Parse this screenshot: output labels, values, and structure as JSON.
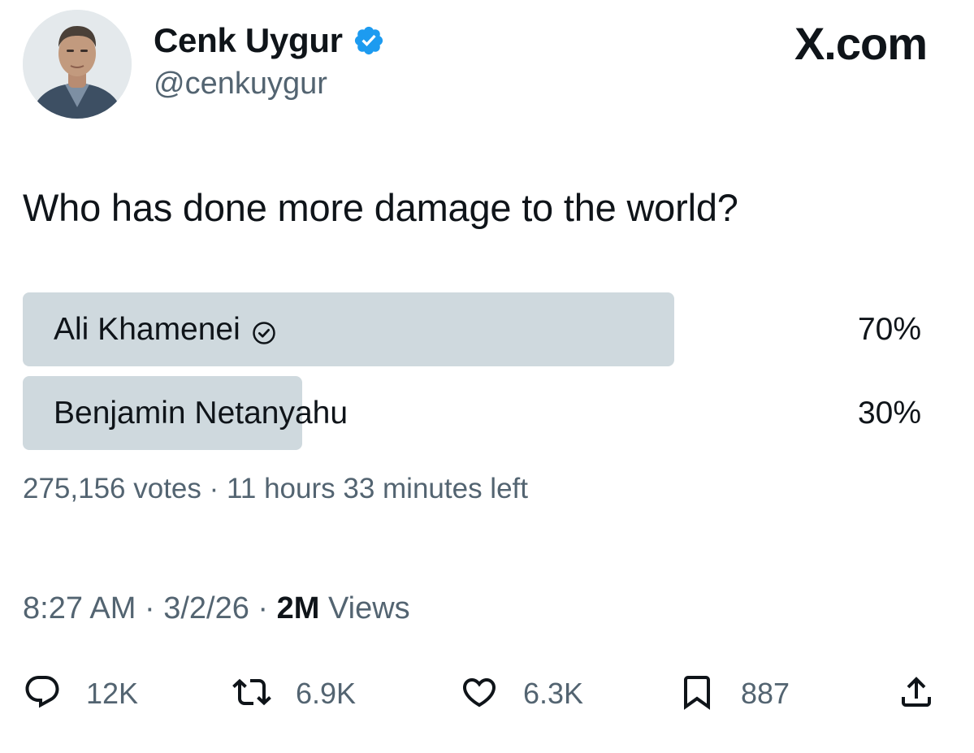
{
  "author": {
    "display_name": "Cenk Uygur",
    "handle": "@cenkuygur",
    "verified": true,
    "verified_color": "#1d9bf0"
  },
  "watermark": "X.com",
  "tweet": {
    "text": "Who has done more damage to the world?"
  },
  "poll": {
    "options": [
      {
        "label": "Ali Khamenei",
        "percent_text": "70%",
        "share": 0.7,
        "winner": true
      },
      {
        "label": "Benjamin Netanyahu",
        "percent_text": "30%",
        "share": 0.3,
        "winner": false
      }
    ],
    "votes_text": "275,156 votes",
    "time_left_text": "11 hours 33 minutes left",
    "bar_color": "#cfd9de"
  },
  "meta": {
    "time": "8:27 AM",
    "date": "3/2/26",
    "views_count": "2M",
    "views_label": "Views"
  },
  "actions": {
    "reply": {
      "icon": "reply-icon",
      "count": "12K"
    },
    "repost": {
      "icon": "repost-icon",
      "count": "6.9K"
    },
    "like": {
      "icon": "heart-icon",
      "count": "6.3K"
    },
    "bookmark": {
      "icon": "bookmark-icon",
      "count": "887"
    },
    "share": {
      "icon": "share-icon"
    }
  },
  "colors": {
    "text_primary": "#0f1419",
    "text_secondary": "#536471"
  }
}
